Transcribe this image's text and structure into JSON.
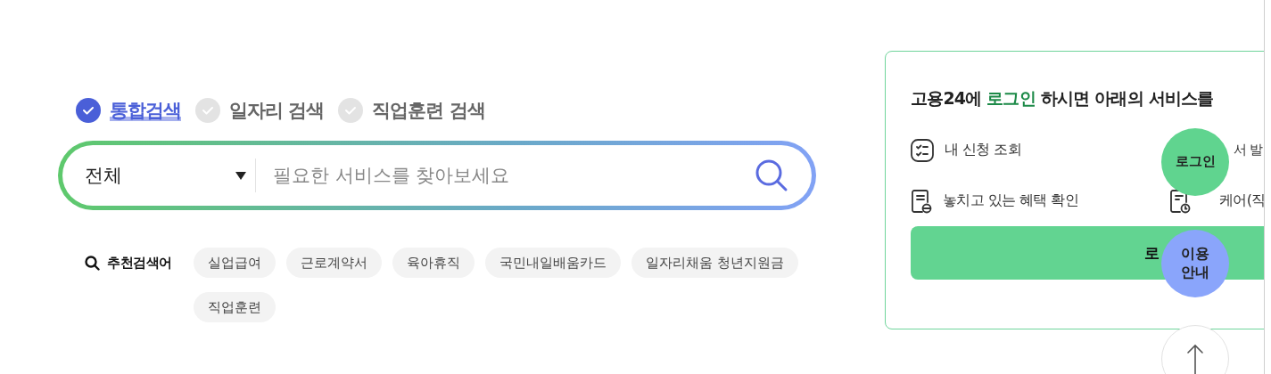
{
  "tabs": [
    {
      "label": "통합검색",
      "selected": true
    },
    {
      "label": "일자리 검색",
      "selected": false
    },
    {
      "label": "직업훈련 검색",
      "selected": false
    }
  ],
  "search": {
    "scope": "전체",
    "placeholder": "필요한 서비스를 찾아보세요"
  },
  "recommended": {
    "label": "추천검색어",
    "keywords": [
      "실업급여",
      "근로계약서",
      "육아휴직",
      "국민내일배움카드",
      "일자리채움 청년지원금",
      "직업훈련"
    ]
  },
  "login_card": {
    "heading": {
      "before": "고용24에",
      "highlight": "로그인",
      "after": "하시면 아래의 서비스를"
    },
    "services": [
      {
        "label": "내 신청 조회",
        "kind": "checklist"
      },
      {
        "label": "서 발",
        "kind": "covered"
      },
      {
        "label": "놓치고 있는 혜택 확인",
        "kind": "receipt"
      },
      {
        "label": "케어(직",
        "kind": "document-clock"
      }
    ],
    "login_button": "로"
  },
  "floating": [
    {
      "kind": "login",
      "lines": [
        "로그인"
      ]
    },
    {
      "kind": "guide",
      "lines": [
        "이용",
        "안내"
      ]
    },
    {
      "kind": "top"
    }
  ]
}
